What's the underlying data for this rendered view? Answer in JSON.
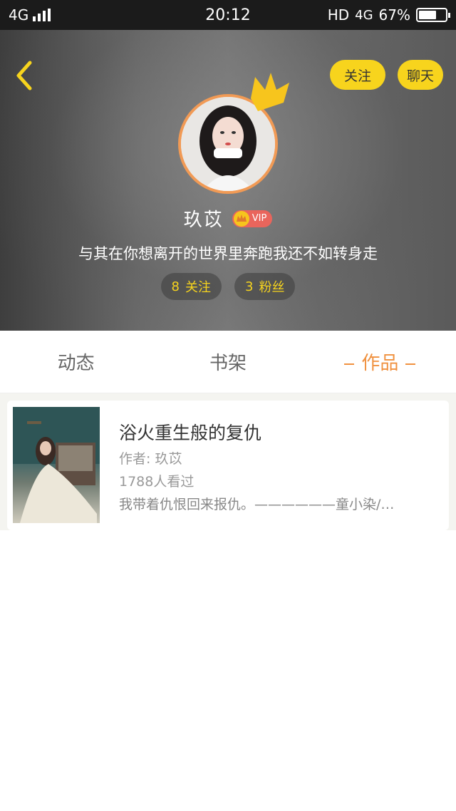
{
  "status_bar": {
    "network": "4G",
    "time": "20:12",
    "hd": "HD",
    "network_right": "4G",
    "battery": "67%",
    "battery_level": 0.67
  },
  "header": {
    "follow_label": "关注",
    "chat_label": "聊天",
    "username": "玖苡",
    "vip_label": "VIP",
    "signature": "与其在你想离开的世界里奔跑我还不如转身走",
    "following_count": "8",
    "following_label": "关注",
    "fans_count": "3",
    "fans_label": "粉丝"
  },
  "tabs": [
    {
      "label": "动态"
    },
    {
      "label": "书架"
    },
    {
      "label": "作品"
    }
  ],
  "works": [
    {
      "title": "浴火重生般的复仇",
      "author": "作者: 玖苡",
      "views": "1788人看过",
      "description": "我带着仇恨回来报仇。——————童小染/…"
    }
  ],
  "colors": {
    "accent_yellow": "#f7d41d",
    "accent_orange": "#f0913f",
    "vip_red": "#e9655c"
  }
}
